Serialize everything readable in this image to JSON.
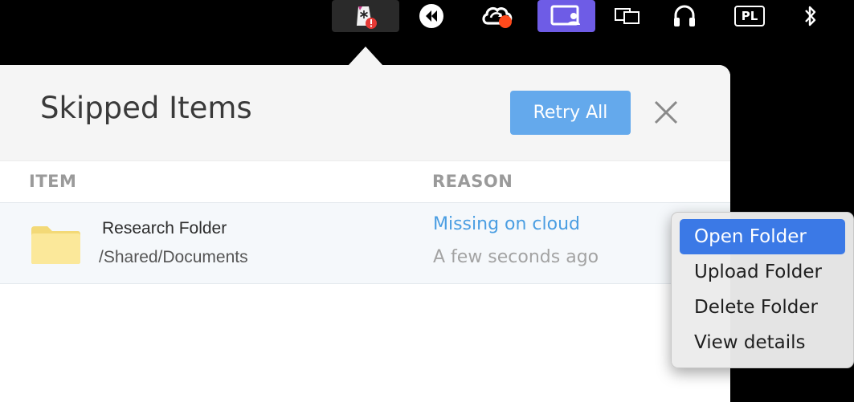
{
  "menubar": {
    "icons": [
      {
        "name": "sync-app-icon",
        "active_bg": "#2a2a2a",
        "alert_color": "#e53935"
      },
      {
        "name": "rewind-icon"
      },
      {
        "name": "cloud-sync-icon",
        "badge_color": "#ff4a1c"
      },
      {
        "name": "screen-share-icon",
        "active_bg": "#6e5ce6"
      },
      {
        "name": "display-mirror-icon"
      },
      {
        "name": "headphones-icon"
      },
      {
        "name": "input-source-badge",
        "label": "PL"
      },
      {
        "name": "bluetooth-icon"
      }
    ]
  },
  "panel": {
    "title": "Skipped Items",
    "retry_label": "Retry All",
    "columns": {
      "item": "ITEM",
      "reason": "REASON"
    },
    "rows": [
      {
        "name": "Research Folder",
        "path": "/Shared/Documents",
        "reason": "Missing on cloud",
        "time": "A few seconds ago"
      }
    ]
  },
  "context_menu": {
    "items": [
      {
        "label": "Open Folder",
        "selected": true
      },
      {
        "label": "Upload Folder",
        "selected": false
      },
      {
        "label": "Delete Folder",
        "selected": false
      },
      {
        "label": "View details",
        "selected": false
      }
    ]
  },
  "colors": {
    "accent": "#64a9ec",
    "link": "#4b9ee2",
    "menu_selection": "#3b79e6",
    "folder": "#fbe89a"
  }
}
